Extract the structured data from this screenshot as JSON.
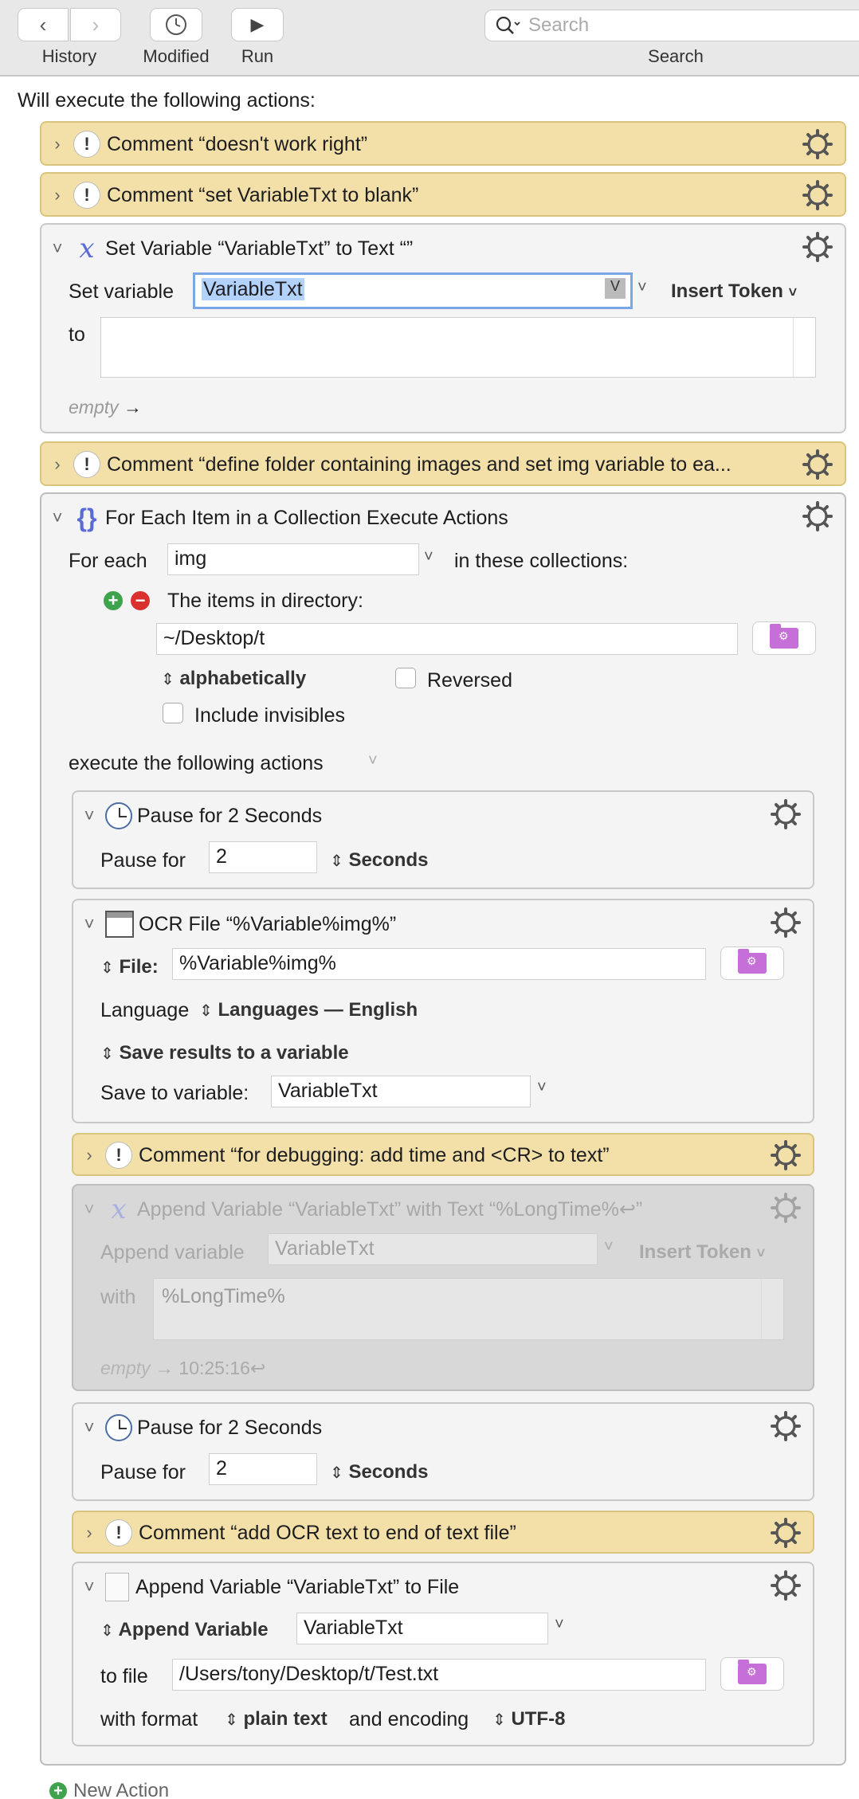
{
  "toolbar": {
    "history_label": "History",
    "modified_label": "Modified",
    "run_label": "Run",
    "search_label": "Search",
    "search_placeholder": "Search",
    "back_icon": "‹",
    "forward_icon": "›",
    "play_icon": "▶"
  },
  "intro": "Will execute the following actions:",
  "actions": {
    "comment1": "Comment “doesn't work right”",
    "comment2": "Comment “set VariableTxt to blank”",
    "setvar": {
      "title": "Set Variable “VariableTxt” to Text “”",
      "set_label": "Set variable",
      "var_value": "VariableTxt",
      "v_badge": "V",
      "insert_token": "Insert Token",
      "to_label": "to",
      "empty_label": "empty",
      "arrow": "→"
    },
    "comment3": "Comment “define folder containing images and set img variable to ea...",
    "foreach": {
      "title": "For Each Item in a Collection Execute Actions",
      "for_each_label": "For each",
      "var_value": "img",
      "collections_label": "in these collections:",
      "items_label": "The items in directory:",
      "dir_value": "~/Desktop/t",
      "sort_label": "alphabetically",
      "reversed_label": "Reversed",
      "invisibles_label": "Include invisibles",
      "execute_label": "execute the following actions",
      "pause1": {
        "title": "Pause for 2 Seconds",
        "label": "Pause for",
        "value": "2",
        "unit": "Seconds"
      },
      "ocr": {
        "title": "OCR File “%Variable%img%”",
        "file_label": "File:",
        "file_value": "%Variable%img%",
        "language_label": "Language",
        "language_value": "Languages — English",
        "save_mode": "Save results to a variable",
        "save_label": "Save to variable:",
        "save_value": "VariableTxt"
      },
      "comment4": "Comment “for debugging: add time and  <CR> to text”",
      "append": {
        "title": "Append Variable “VariableTxt” with Text “%LongTime%↩”",
        "label": "Append variable",
        "var_value": "VariableTxt",
        "insert_token": "Insert Token",
        "with_label": "with",
        "with_value": "%LongTime%",
        "preview_empty": "empty",
        "preview_value": "10:25:16↩",
        "arrow": "→"
      },
      "pause2": {
        "title": "Pause for 2 Seconds",
        "label": "Pause for",
        "value": "2",
        "unit": "Seconds"
      },
      "comment5": "Comment “add OCR text to end of text file”",
      "appendfile": {
        "title": "Append Variable “VariableTxt” to File",
        "mode_label": "Append Variable",
        "var_value": "VariableTxt",
        "tofile_label": "to file",
        "file_value": "/Users/tony/Desktop/t/Test.txt",
        "format_label": "with format",
        "format_value": "plain text",
        "encoding_label": "and encoding",
        "encoding_value": "UTF-8"
      }
    }
  },
  "new_action": "New Action",
  "colors": {
    "comment_bg": "#f2e0a8",
    "action_bg": "#f4f4f4",
    "disabled_bg": "#d8d8d8",
    "folder_purple": "#c66fd8",
    "variable_blue": "#5b6bd6"
  },
  "icons": {
    "gear": "gear-icon",
    "comment": "exclamation-icon",
    "variable": "x-variable-icon",
    "foreach": "braces-icon",
    "pause": "clock-icon",
    "ocr": "window-icon",
    "file": "file-icon",
    "folder": "folder-icon",
    "search": "search-icon"
  }
}
